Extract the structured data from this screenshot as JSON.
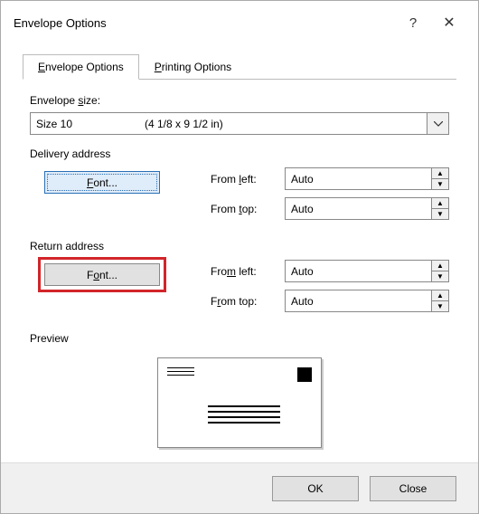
{
  "dialog": {
    "title": "Envelope Options",
    "help_symbol": "?",
    "close_symbol": "✕"
  },
  "tabs": {
    "envelope": "Envelope Options",
    "printing": "Printing Options"
  },
  "envelope_size": {
    "label": "Envelope size:",
    "value": "Size 10",
    "info": "(4 1/8 x 9 1/2 in)"
  },
  "delivery": {
    "title": "Delivery address",
    "font_label": "Font...",
    "from_left_label": "From left:",
    "from_left_value": "Auto",
    "from_top_label": "From top:",
    "from_top_value": "Auto"
  },
  "return": {
    "title": "Return address",
    "font_label": "Font...",
    "from_left_label": "From left:",
    "from_left_value": "Auto",
    "from_top_label": "From top:",
    "from_top_value": "Auto"
  },
  "preview": {
    "label": "Preview"
  },
  "buttons": {
    "ok": "OK",
    "close": "Close"
  }
}
